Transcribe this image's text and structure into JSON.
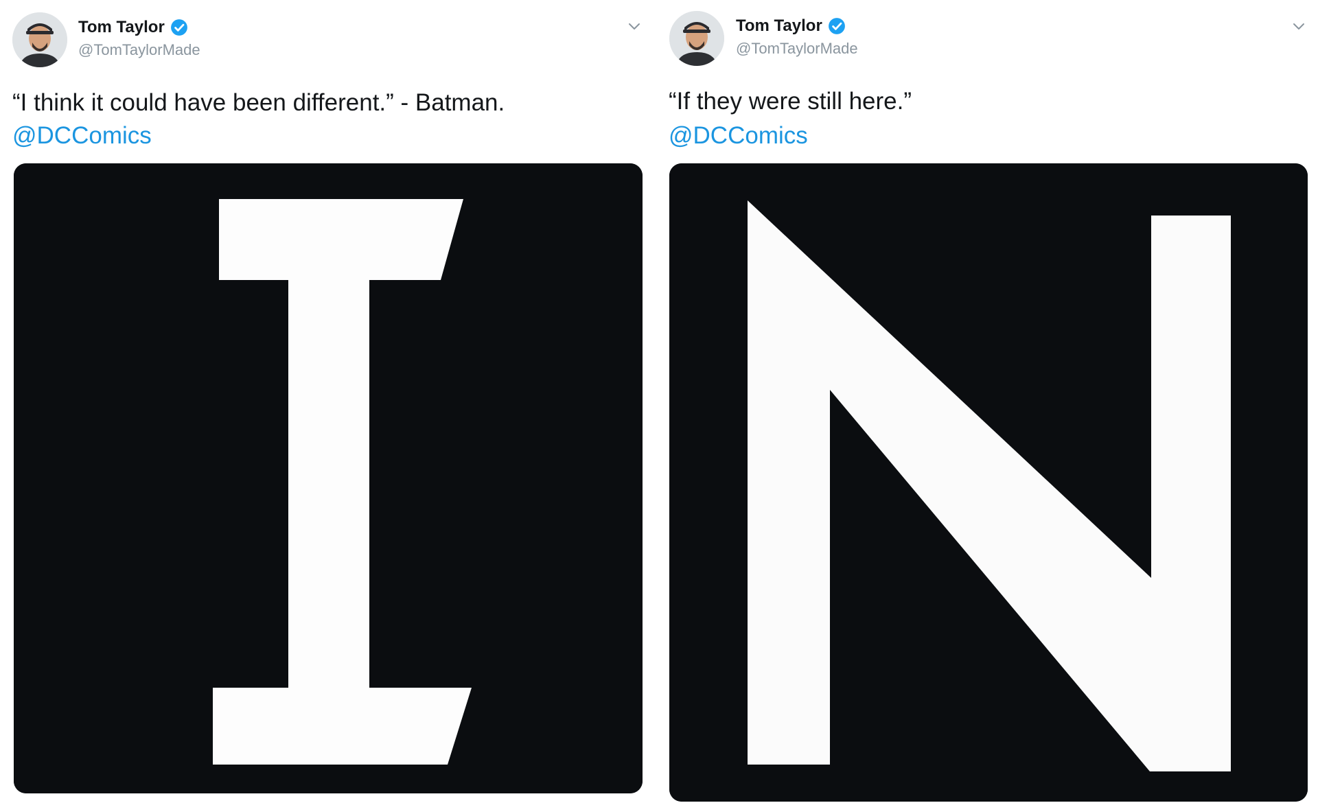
{
  "tweets": [
    {
      "author": {
        "display_name": "Tom Taylor",
        "handle": "@TomTaylorMade",
        "verified": true,
        "avatar_icon": "user-avatar-photo"
      },
      "text": "“I think it could have been different.” - Batman.",
      "mention": "@DCComics",
      "media": {
        "letter": "I",
        "description_icon": "letter-I-image"
      }
    },
    {
      "author": {
        "display_name": "Tom Taylor",
        "handle": "@TomTaylorMade",
        "verified": true,
        "avatar_icon": "user-avatar-photo"
      },
      "text": "“If they were still here.”",
      "mention": "@DCComics",
      "media": {
        "letter": "N",
        "description_icon": "letter-N-image"
      }
    }
  ],
  "colors": {
    "mention": "#1b95e0",
    "verified_badge": "#1da1f2",
    "handle": "#8a959e",
    "media_background": "#0b0d10"
  }
}
